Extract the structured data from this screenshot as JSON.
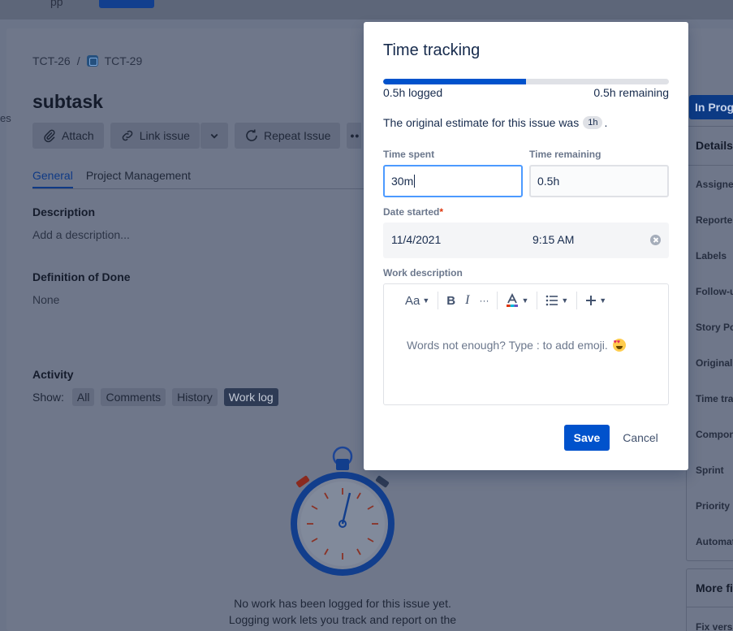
{
  "topbar": {
    "partial_text": "pp"
  },
  "issue": {
    "breadcrumb": {
      "parent": "TCT-26",
      "separator": "/",
      "current": "TCT-29"
    },
    "title": "subtask",
    "side_partial": "es",
    "toolbar": {
      "attach": "Attach",
      "link": "Link issue",
      "repeat": "Repeat Issue"
    },
    "tabs": [
      "General",
      "Project Management"
    ],
    "description": {
      "heading": "Description",
      "placeholder": "Add a description..."
    },
    "dod": {
      "heading": "Definition of Done",
      "value": "None"
    },
    "activity": {
      "heading": "Activity",
      "show_label": "Show:",
      "filters": [
        "All",
        "Comments",
        "History",
        "Work log"
      ],
      "active_filter": "Work log"
    },
    "empty_state": {
      "line1": "No work has been logged for this issue yet.",
      "line2": "Logging work lets you track and report on the"
    }
  },
  "sidebar": {
    "status": "In Progress",
    "details_heading": "Details",
    "fields": [
      "Assignee",
      "Reporter",
      "Labels",
      "Follow-up",
      "Story Points",
      "Original estimate",
      "Time tracking",
      "Components",
      "Sprint",
      "Priority",
      "Automation"
    ],
    "more_heading": "More fields",
    "more_fields": [
      "Fix versions"
    ]
  },
  "modal": {
    "title": "Time tracking",
    "progress_fraction": 0.5,
    "logged": "0.5h logged",
    "remaining": "0.5h remaining",
    "estimate_prefix": "The original estimate for this issue was",
    "estimate_value": "1h",
    "estimate_suffix": ".",
    "time_spent": {
      "label": "Time spent",
      "value": "30m"
    },
    "time_remaining": {
      "label": "Time remaining",
      "value": "0.5h"
    },
    "date_started": {
      "label": "Date started",
      "required_mark": "*",
      "date": "11/4/2021",
      "time": "9:15 AM"
    },
    "work_description": {
      "label": "Work description",
      "toolbar": {
        "text_style": "Aa",
        "bold": "B",
        "italic": "I",
        "more": "···"
      },
      "placeholder": "Words not enough? Type : to add emoji."
    },
    "save": "Save",
    "cancel": "Cancel"
  },
  "colors": {
    "primary": "#0052cc",
    "focus_border": "#4c9aff",
    "overlay_bg": "#6b7488"
  }
}
